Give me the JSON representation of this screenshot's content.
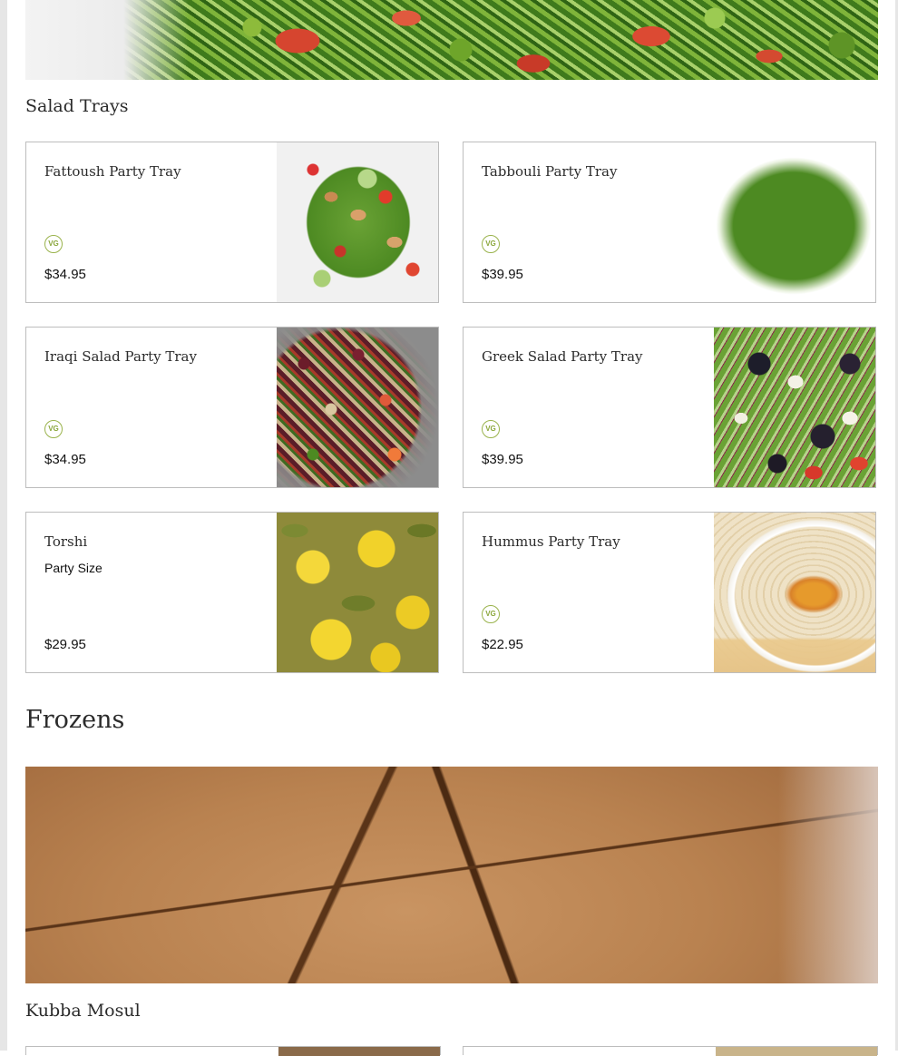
{
  "sections": {
    "salad_trays": {
      "title": "Salad Trays",
      "items": [
        {
          "name": "Fattoush Party Tray",
          "badge": "VG",
          "price": "$34.95",
          "image_icon": "fattoush-image"
        },
        {
          "name": "Tabbouli Party Tray",
          "badge": "VG",
          "price": "$39.95",
          "image_icon": "tabbouli-image"
        },
        {
          "name": "Iraqi Salad Party Tray",
          "badge": "VG",
          "price": "$34.95",
          "image_icon": "iraqi-salad-image"
        },
        {
          "name": "Greek Salad Party Tray",
          "badge": "VG",
          "price": "$39.95",
          "image_icon": "greek-salad-image"
        },
        {
          "name": "Torshi",
          "description": "Party Size",
          "price": "$29.95",
          "image_icon": "torshi-image"
        },
        {
          "name": "Hummus Party Tray",
          "badge": "VG",
          "price": "$22.95",
          "image_icon": "hummus-image"
        }
      ]
    },
    "frozens": {
      "title": "Frozens"
    },
    "kubba_mosul": {
      "title": "Kubba Mosul"
    }
  },
  "colors": {
    "card_border": "#bdbdbd",
    "vg_badge": "#9ab34c",
    "heading_text": "#2b2b2b",
    "price_text": "#111111"
  }
}
